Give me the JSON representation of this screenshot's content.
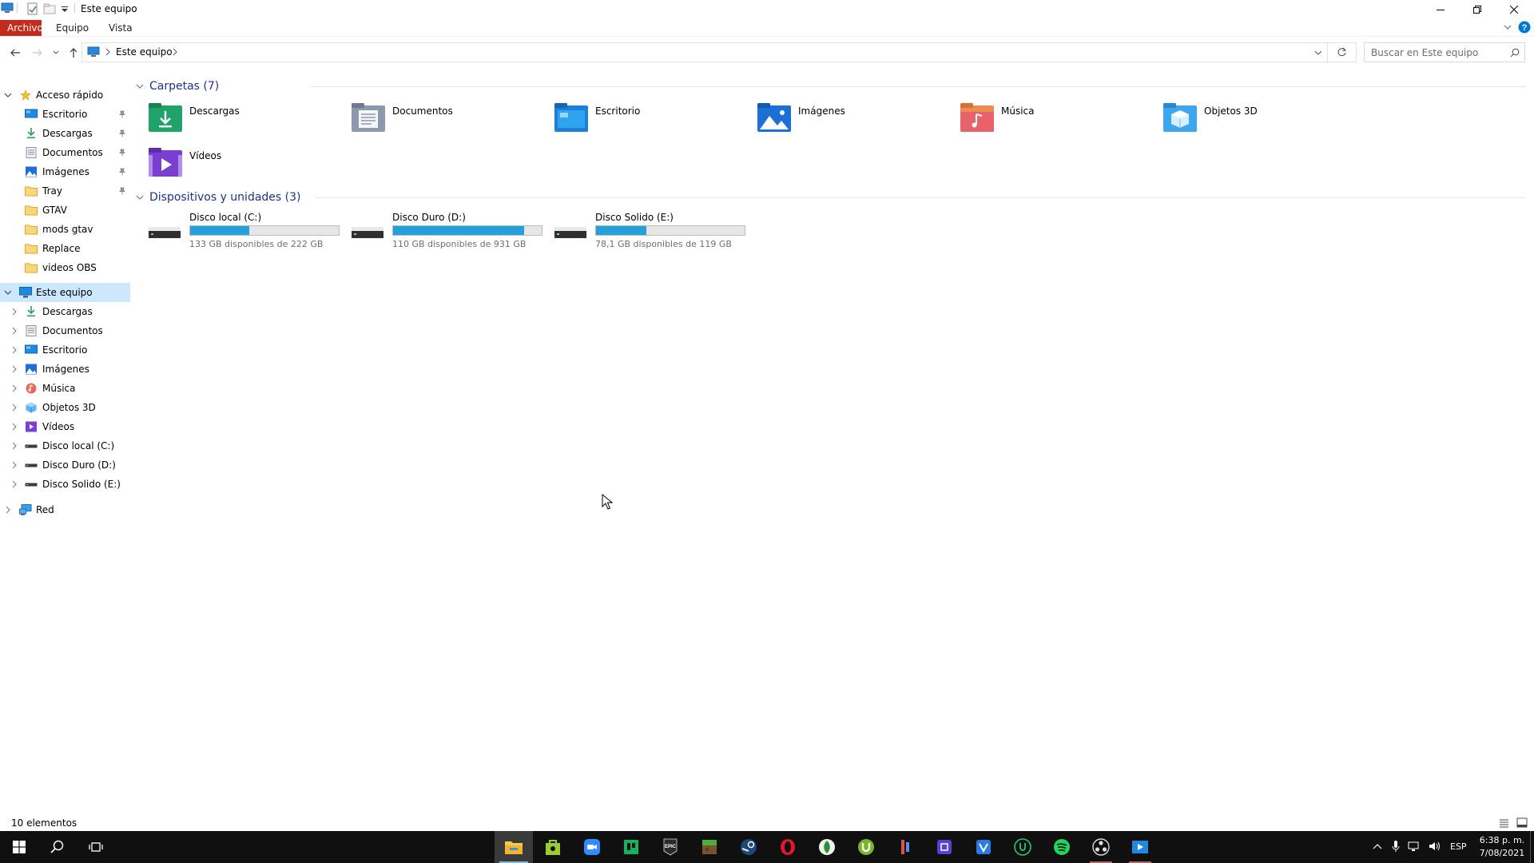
{
  "window": {
    "title": "Este equipo"
  },
  "ribbon": {
    "tabs": [
      "Archivo",
      "Equipo",
      "Vista"
    ]
  },
  "address": {
    "path_item": "Este equipo",
    "search_placeholder": "Buscar en Este equipo"
  },
  "nav": {
    "quick_access_label": "Acceso rápido",
    "quick_access": [
      {
        "label": "Escritorio",
        "icon": "desktop-icon",
        "pinned": true
      },
      {
        "label": "Descargas",
        "icon": "download-icon",
        "pinned": true
      },
      {
        "label": "Documentos",
        "icon": "document-icon",
        "pinned": true
      },
      {
        "label": "Imágenes",
        "icon": "pictures-icon",
        "pinned": true
      },
      {
        "label": "Tray",
        "icon": "folder-icon",
        "pinned": true
      },
      {
        "label": "GTAV",
        "icon": "folder-icon",
        "pinned": false
      },
      {
        "label": "mods gtav",
        "icon": "folder-icon",
        "pinned": false
      },
      {
        "label": "Replace",
        "icon": "folder-icon",
        "pinned": false
      },
      {
        "label": "videos OBS",
        "icon": "folder-icon",
        "pinned": false
      }
    ],
    "this_pc_label": "Este equipo",
    "this_pc": [
      {
        "label": "Descargas",
        "icon": "download-icon"
      },
      {
        "label": "Documentos",
        "icon": "document-icon"
      },
      {
        "label": "Escritorio",
        "icon": "desktop-icon"
      },
      {
        "label": "Imágenes",
        "icon": "pictures-icon"
      },
      {
        "label": "Música",
        "icon": "music-icon"
      },
      {
        "label": "Objetos 3D",
        "icon": "objects-3d-icon"
      },
      {
        "label": "Vídeos",
        "icon": "videos-icon"
      },
      {
        "label": "Disco local (C:)",
        "icon": "drive-icon"
      },
      {
        "label": "Disco Duro  (D:)",
        "icon": "drive-icon"
      },
      {
        "label": "Disco Solido (E:)",
        "icon": "drive-icon"
      }
    ],
    "network_label": "Red"
  },
  "content": {
    "folders_header": "Carpetas (7)",
    "folders": [
      {
        "label": "Descargas",
        "icon": "download-folder-icon"
      },
      {
        "label": "Documentos",
        "icon": "document-folder-icon"
      },
      {
        "label": "Escritorio",
        "icon": "desktop-folder-icon"
      },
      {
        "label": "Imágenes",
        "icon": "pictures-folder-icon"
      },
      {
        "label": "Música",
        "icon": "music-folder-icon"
      },
      {
        "label": "Objetos 3D",
        "icon": "objects-3d-folder-icon"
      },
      {
        "label": "Vídeos",
        "icon": "videos-folder-icon"
      }
    ],
    "devices_header": "Dispositivos y unidades (3)",
    "drives": [
      {
        "name": "Disco local (C:)",
        "free": "133 GB disponibles de 222 GB",
        "used_fraction": 0.4
      },
      {
        "name": "Disco Duro  (D:)",
        "free": "110 GB disponibles de 931 GB",
        "used_fraction": 0.88
      },
      {
        "name": "Disco Solido (E:)",
        "free": "78,1 GB disponibles de 119 GB",
        "used_fraction": 0.34
      }
    ]
  },
  "status": {
    "items_count": "10 elementos"
  },
  "taskbar": {
    "lang": "ESP",
    "time": "6:38 p. m.",
    "date": "7/08/2021"
  },
  "colors": {
    "accent": "#0078d7",
    "file_tab": "#c42b1c",
    "drive_fill": "#26a0da",
    "selected": "#cce8ff"
  }
}
